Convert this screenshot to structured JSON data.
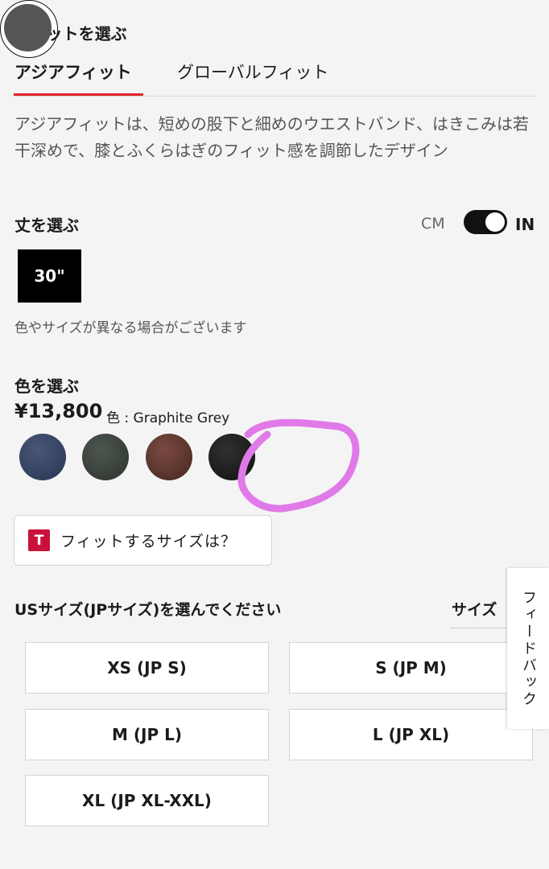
{
  "fit": {
    "title": "フィットを選ぶ",
    "tabs": [
      {
        "label": "アジアフィット",
        "active": true
      },
      {
        "label": "グローバルフィット",
        "active": false
      }
    ],
    "description": "アジアフィットは、短めの股下と細めのウエストバンド、はきこみは若干深めで、膝とふくらはぎのフィット感を調節したデザイン"
  },
  "length": {
    "title": "丈を選ぶ",
    "unit_cm": "CM",
    "unit_in": "IN",
    "unit_selected": "IN",
    "selected": "30\"",
    "note": "色やサイズが異なる場合がございます"
  },
  "color": {
    "title": "色を選ぶ",
    "price": "¥13,800",
    "color_label": "色 : Graphite Grey",
    "selected": "Graphite Grey",
    "swatch_colors": [
      "#2f3c5c",
      "#363d38",
      "#5b342c",
      "#1a1a1a",
      "#555555"
    ],
    "highlight_color": "#e07ae8"
  },
  "fit_finder": {
    "logo": "T",
    "label": "フィットするサイズは？",
    "logo_color": "#c8123b"
  },
  "size": {
    "title": "USサイズ(JPサイズ)を選んでください",
    "guide_label": "サイズ",
    "options": [
      "XS (JP S)",
      "S (JP M)",
      "M (JP L)",
      "L (JP XL)",
      "XL (JP XL-XXL)"
    ]
  },
  "feedback": {
    "label": "フィードバック"
  },
  "colors": {
    "accent": "#e0252a",
    "background": "#f4f4f4"
  }
}
